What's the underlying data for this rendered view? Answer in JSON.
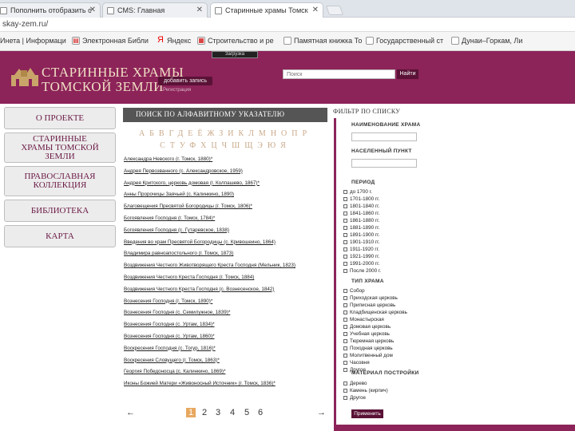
{
  "browser": {
    "tabs": [
      {
        "title": "Пополнить отобразить с"
      },
      {
        "title": "CMS: Главная"
      },
      {
        "title": "Старинные храмы Томск"
      }
    ],
    "url": "skay-zem.ru/",
    "bookmarks": [
      {
        "label": "Инета | Информаци",
        "icon": "page-icon"
      },
      {
        "label": "Электронная Библи",
        "icon": "book-icon"
      },
      {
        "label": "Яндекс",
        "icon": "yandex-icon"
      },
      {
        "label": "Строительство и ре",
        "icon": "build-icon"
      },
      {
        "label": "Памятная книжка То",
        "icon": "page-icon"
      },
      {
        "label": "Государственный ст",
        "icon": "page-icon"
      },
      {
        "label": "Дунаи–Горкам, Ли",
        "icon": "page-icon"
      }
    ]
  },
  "tooltip": "Загрузка",
  "header": {
    "title_line1": "СТАРИННЫЕ ХРАМЫ",
    "title_line2": "ТОМСКОЙ ЗЕМЛИ",
    "add_button": "добавить запись",
    "add_sub": "Регистрация",
    "search_placeholder": "Поиск",
    "search_button": "Найти"
  },
  "sidebar": [
    {
      "label": "О ПРОЕКТЕ"
    },
    {
      "label": "СТАРИННЫЕ ХРАМЫ ТОМСКОЙ ЗЕМЛИ"
    },
    {
      "label": "ПРАВОСЛАВНАЯ КОЛЛЕКЦИЯ"
    },
    {
      "label": "БИБЛИОТЕКА"
    },
    {
      "label": "КАРТА"
    }
  ],
  "main": {
    "heading": "ПОИСК ПО АЛФАВИТНОМУ УКАЗАТЕЛЮ",
    "alphabet_row1": "АБВГДЕЁЖЗИКЛМНОПР",
    "alphabet_row2": "СТУФХЦЧШЩЭЮЯ",
    "entries": [
      "Александра Невского (г. Томск, 1880)*",
      "Андрея Первозванного (с. Александровское, 1959)",
      "Андрея Критского, церковь домовая (г. Колпашево, 1867)*",
      "Анны Пророчицы Заячьей (с. Калинкино, 1890)",
      "Благовещения Пресвятой Богородицы (г. Томск, 1806)*",
      "Богоявления Господня (г. Томск, 1784)*",
      "Богоявления Господня (с. Гутаревское, 1838)",
      "Введения во храм Пресвятой Богородицы (с. Кривошеино, 1864)",
      "Владимира равноапостольного (г. Томск, 1873)",
      "Воздвижения Честного Животворящего Креста Господня (Мельник, 1823)",
      "Воздвижения Честного Креста Господня (г. Томск, 1884)",
      "Воздвижения Честного Креста Господня (с. Вознесенское, 1842)",
      "Вознесения Господня (г. Томск, 1890)*",
      "Вознесения Господня (с. Семилужное, 1839)*",
      "Вознесения Господня (с. Уртам, 1834)*",
      "Вознесения Господня (с. Уртам, 1860)*",
      "Воскресения Господня (с. Тогур, 1816)*",
      "Воскресения Словущего (г. Томск, 1863)*",
      "Георгия Победоносца (с. Калинкино, 1869)*",
      "Иконы Божией Матери «Живоносный Источник» (г. Томск, 1836)*"
    ],
    "pagination": {
      "prev": "←",
      "pages": [
        "1",
        "2",
        "3",
        "4",
        "5",
        "6"
      ],
      "current": "1",
      "next": "→"
    }
  },
  "filters": {
    "title": "ФИЛЬТР ПО СПИСКУ",
    "name_label": "НАИМЕНОВАНИЕ ХРАМА",
    "place_label": "НАСЕЛЕННЫЙ ПУНКТ",
    "period_label": "ПЕРИОД",
    "periods": [
      "до 1700 г.",
      "1701-1800 гг.",
      "1801-1840 гг.",
      "1841-1860 гг.",
      "1861-1880 гг.",
      "1881-1890 гг.",
      "1891-1900 гг.",
      "1901-1910 гг.",
      "1911-1920 гг.",
      "1921-1990 гг.",
      "1991-2000 гг.",
      "После 2000 г."
    ],
    "type_label": "ТИП ХРАМА",
    "types": [
      "Собор",
      "Приходская церковь",
      "Приписная церковь",
      "Кладбищенская церковь",
      "Монастырская",
      "Домовая церковь",
      "Учебная церковь",
      "Тюремная церковь",
      "Походная церковь",
      "Молитвенный дом",
      "Часовня",
      "Другое"
    ],
    "material_label": "МАТЕРИАЛ ПОСТРОЙКИ",
    "materials": [
      "Дерево",
      "Камень (кирпич)",
      "Другое"
    ],
    "apply_button": "Применить"
  }
}
